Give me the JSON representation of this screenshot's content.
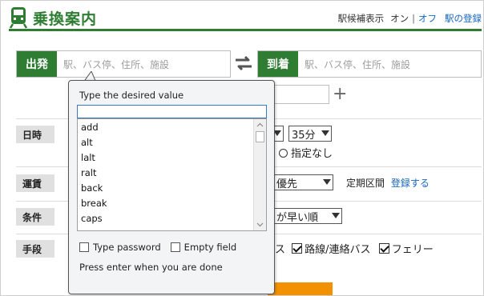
{
  "header": {
    "title": "乗換案内",
    "station_display_label": "駅候補表示",
    "on_label": "オン",
    "separator": "|",
    "off_label": "オフ",
    "station_register": "駅の登録"
  },
  "search": {
    "from_tag": "出発",
    "from_placeholder": "駅、バス停、住所、施設",
    "to_tag": "到着",
    "to_placeholder": "駅、バス停、住所、施設"
  },
  "rows": {
    "datetime_label": "日時",
    "minute_value": "35分",
    "no_spec_label": "指定なし",
    "fare_label": "運賃",
    "fare_select": "優先",
    "commuter_label": "定期区間",
    "register_link": "登録する",
    "condition_label": "条件",
    "condition_select": "が早い順",
    "means_label": "手段",
    "means_bus_tail": "ス",
    "means_route_bus": "路線/連絡バス",
    "means_ferry": "フェリー"
  },
  "popup": {
    "title": "Type the desired value",
    "input_value": "",
    "options": [
      "add",
      "alt",
      "lalt",
      "ralt",
      "back",
      "break",
      "caps"
    ],
    "type_password_label": "Type password",
    "empty_field_label": "Empty field",
    "hint": "Press enter when you are done"
  },
  "colors": {
    "brand_green": "#2e7d32",
    "link_blue": "#1565c0",
    "button_orange": "#f39200"
  }
}
